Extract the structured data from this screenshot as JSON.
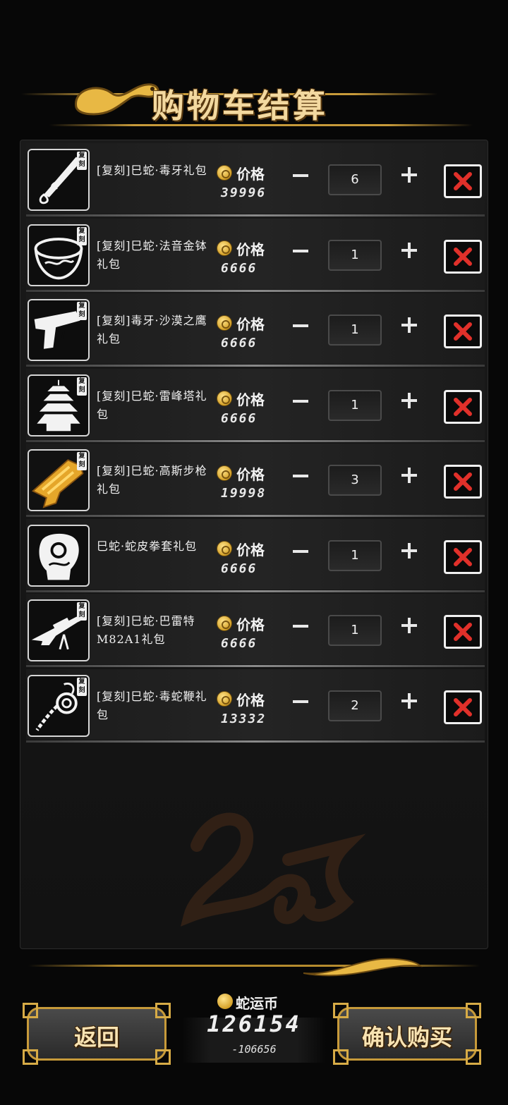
{
  "header": {
    "title": "购物车结算"
  },
  "cart": {
    "price_label": "价格",
    "items": [
      {
        "tag": "复刻",
        "name": "[复刻]巳蛇·毒牙礼包",
        "price": "39996",
        "qty": "6",
        "icon": "dagger-icon"
      },
      {
        "tag": "复刻",
        "name": "[复刻]巳蛇·法音金钵礼包",
        "price": "6666",
        "qty": "1",
        "icon": "bowl-icon"
      },
      {
        "tag": "复刻",
        "name": "[复刻]毒牙·沙漠之鹰礼包",
        "price": "6666",
        "qty": "1",
        "icon": "pistol-icon"
      },
      {
        "tag": "复刻",
        "name": "[复刻]巳蛇·雷峰塔礼包",
        "price": "6666",
        "qty": "1",
        "icon": "pagoda-icon"
      },
      {
        "tag": "复刻",
        "name": "[复刻]巳蛇·高斯步枪礼包",
        "price": "19998",
        "qty": "3",
        "icon": "gauss-rifle-icon"
      },
      {
        "tag": "",
        "name": "巳蛇·蛇皮拳套礼包",
        "price": "6666",
        "qty": "1",
        "icon": "glove-icon"
      },
      {
        "tag": "复刻",
        "name": "[复刻]巳蛇·巴雷特M82A1礼包",
        "price": "6666",
        "qty": "1",
        "icon": "sniper-rifle-icon"
      },
      {
        "tag": "复刻",
        "name": "[复刻]巳蛇·毒蛇鞭礼包",
        "price": "13332",
        "qty": "2",
        "icon": "whip-icon"
      }
    ]
  },
  "footer": {
    "back_label": "返回",
    "confirm_label": "确认购买",
    "currency_label": "蛇运币",
    "balance": "126154",
    "change": "-106656"
  },
  "colors": {
    "accent_gold": "#c79a3a",
    "delete_red": "#e0302a"
  }
}
